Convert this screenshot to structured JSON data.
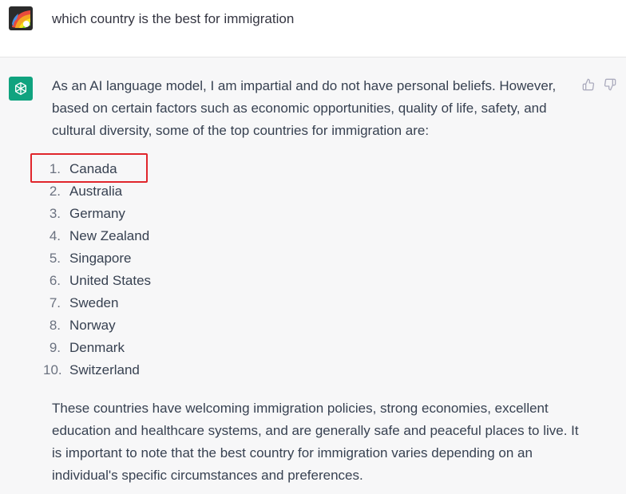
{
  "user": {
    "avatar_icon": "user-avatar-icon",
    "message": "which country is the best for immigration"
  },
  "assistant": {
    "avatar_icon": "openai-logo-icon",
    "intro": "As an AI language model, I am impartial and do not have personal beliefs. However, based on certain factors such as economic opportunities, quality of life, safety, and cultural diversity, some of the top countries for immigration are:",
    "list": [
      {
        "num": "1.",
        "label": "Canada"
      },
      {
        "num": "2.",
        "label": "Australia"
      },
      {
        "num": "3.",
        "label": "Germany"
      },
      {
        "num": "4.",
        "label": "New Zealand"
      },
      {
        "num": "5.",
        "label": "Singapore"
      },
      {
        "num": "6.",
        "label": "United States"
      },
      {
        "num": "7.",
        "label": "Sweden"
      },
      {
        "num": "8.",
        "label": "Norway"
      },
      {
        "num": "9.",
        "label": "Denmark"
      },
      {
        "num": "10.",
        "label": "Switzerland"
      }
    ],
    "outro": "These countries have welcoming immigration policies, strong economies, excellent education and healthcare systems, and are generally safe and peaceful places to live. It is important to note that the best country for immigration varies depending on an individual's specific circumstances and preferences.",
    "feedback": {
      "up_icon": "thumbs-up-icon",
      "down_icon": "thumbs-down-icon"
    }
  },
  "colors": {
    "accent": "#10a37f",
    "highlight": "#e0262c"
  }
}
